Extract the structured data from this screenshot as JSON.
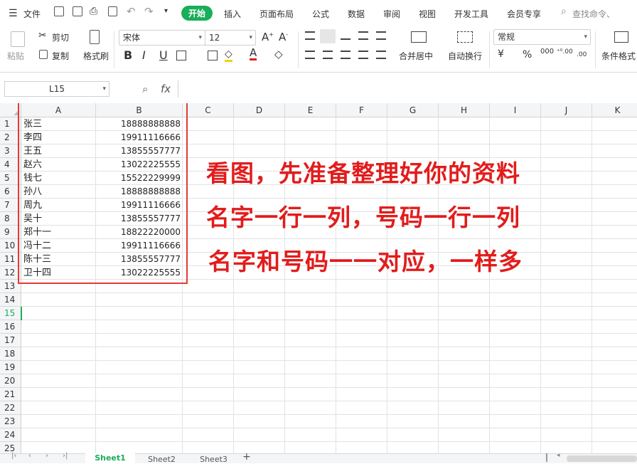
{
  "menu": {
    "file": "文件",
    "tabs": [
      "开始",
      "插入",
      "页面布局",
      "公式",
      "数据",
      "审阅",
      "视图",
      "开发工具",
      "会员专享"
    ],
    "search_placeholder": "查找命令、"
  },
  "ribbon": {
    "paste": "粘贴",
    "cut": "剪切",
    "copy": "复制",
    "format_painter": "格式刷",
    "font_name": "宋体",
    "font_size": "12",
    "merge_center": "合并居中",
    "wrap_text": "自动换行",
    "number_format": "常规",
    "percent": "%",
    "thousands": "000",
    "dec_inc": "⁺⁰.00",
    "dec_dec": ".00",
    "conditional_format": "条件格式",
    "bold": "B",
    "italic": "I",
    "underline": "U"
  },
  "formula_bar": {
    "cell_ref": "L15",
    "fx": "fx"
  },
  "grid": {
    "columns": [
      "A",
      "B",
      "C",
      "D",
      "E",
      "F",
      "G",
      "H",
      "I",
      "J",
      "K"
    ],
    "rows": [
      "1",
      "2",
      "3",
      "4",
      "5",
      "6",
      "7",
      "8",
      "9",
      "10",
      "11",
      "12",
      "13",
      "14",
      "15",
      "16",
      "17",
      "18",
      "19",
      "20",
      "21",
      "22",
      "23",
      "24",
      "25"
    ],
    "names": [
      "张三",
      "李四",
      "王五",
      "赵六",
      "钱七",
      "孙八",
      "周九",
      "吴十",
      "郑十一",
      "冯十二",
      "陈十三",
      "卫十四"
    ],
    "phones": [
      "18888888888",
      "19911116666",
      "13855557777",
      "13022225555",
      "15522229999",
      "18888888888",
      "19911116666",
      "13855557777",
      "18822220000",
      "19911116666",
      "13855557777",
      "13022225555"
    ]
  },
  "annotation": {
    "line1": "看图，先准备整理好你的资料",
    "line2": "名字一行一列，号码一行一列",
    "line3": "名字和号码一一对应，一样多"
  },
  "sheets": [
    "Sheet1",
    "Sheet2",
    "Sheet3"
  ],
  "colors": {
    "accent": "#1aad5a",
    "note": "#e21c1c",
    "box": "#e53935"
  }
}
